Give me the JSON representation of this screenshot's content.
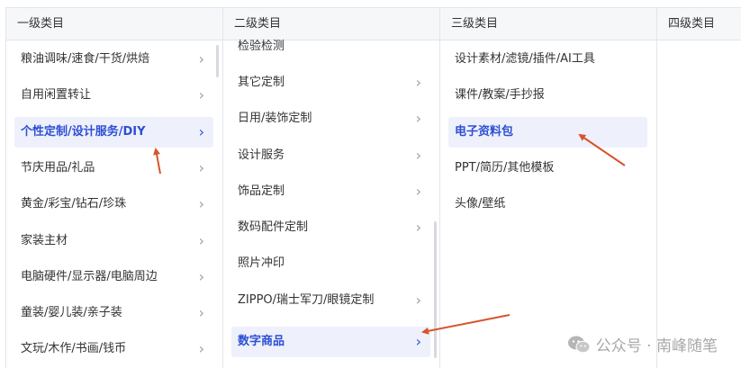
{
  "columns": [
    {
      "header": "一级类目"
    },
    {
      "header": "二级类目"
    },
    {
      "header": "三级类目"
    },
    {
      "header": "四级类目"
    }
  ],
  "level1": {
    "items": [
      {
        "label": "粮油调味/速食/干货/烘焙"
      },
      {
        "label": "自用闲置转让"
      },
      {
        "label": "个性定制/设计服务/DIY"
      },
      {
        "label": "节庆用品/礼品"
      },
      {
        "label": "黄金/彩宝/钻石/珍珠"
      },
      {
        "label": "家装主材"
      },
      {
        "label": "电脑硬件/显示器/电脑周边"
      },
      {
        "label": "童装/婴儿装/亲子装"
      },
      {
        "label": "文玩/木作/书画/钱币"
      }
    ]
  },
  "level2": {
    "items": [
      {
        "label": "检验检测"
      },
      {
        "label": "其它定制"
      },
      {
        "label": "日用/装饰定制"
      },
      {
        "label": "设计服务"
      },
      {
        "label": "饰品定制"
      },
      {
        "label": "数码配件定制"
      },
      {
        "label": "照片冲印"
      },
      {
        "label": "ZIPPO/瑞士军刀/眼镜定制"
      },
      {
        "label": "数字商品"
      }
    ]
  },
  "level3": {
    "items": [
      {
        "label": "设计素材/滤镜/插件/AI工具"
      },
      {
        "label": "课件/教案/手抄报"
      },
      {
        "label": "电子资料包"
      },
      {
        "label": "PPT/简历/其他模板"
      },
      {
        "label": "头像/壁纸"
      }
    ]
  },
  "chevron": "›",
  "watermark": {
    "text": "公众号 · 南峰随笔",
    "icon": "wechat-icon"
  },
  "colors": {
    "accent": "#2d4fd3",
    "selected_bg": "#eef1fc",
    "annotation_arrow": "#d9532c"
  }
}
